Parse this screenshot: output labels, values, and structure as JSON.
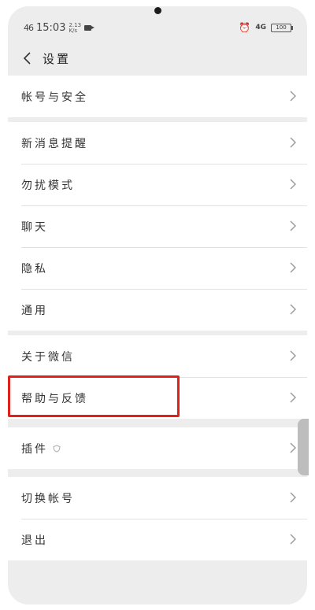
{
  "status_bar": {
    "signal": "46",
    "time": "15:03",
    "speed_top": "2.13",
    "speed_bottom": "K/s",
    "network": "4G",
    "battery": "100"
  },
  "header": {
    "title": "设置"
  },
  "groups": [
    {
      "items": [
        {
          "label": "帐号与安全"
        }
      ]
    },
    {
      "items": [
        {
          "label": "新消息提醒"
        },
        {
          "label": "勿扰模式"
        },
        {
          "label": "聊天"
        },
        {
          "label": "隐私"
        },
        {
          "label": "通用"
        }
      ]
    },
    {
      "items": [
        {
          "label": "关于微信"
        },
        {
          "label": "帮助与反馈"
        }
      ]
    },
    {
      "items": [
        {
          "label": "插件"
        }
      ]
    },
    {
      "items": [
        {
          "label": "切换帐号"
        },
        {
          "label": "退出"
        }
      ]
    }
  ],
  "colors": {
    "background": "#ededed",
    "highlight_box": "#e0201b"
  },
  "icons": {
    "back": "chevron-left-icon",
    "row_arrow": "chevron-right-icon",
    "plugin_badge": "shield-icon"
  }
}
